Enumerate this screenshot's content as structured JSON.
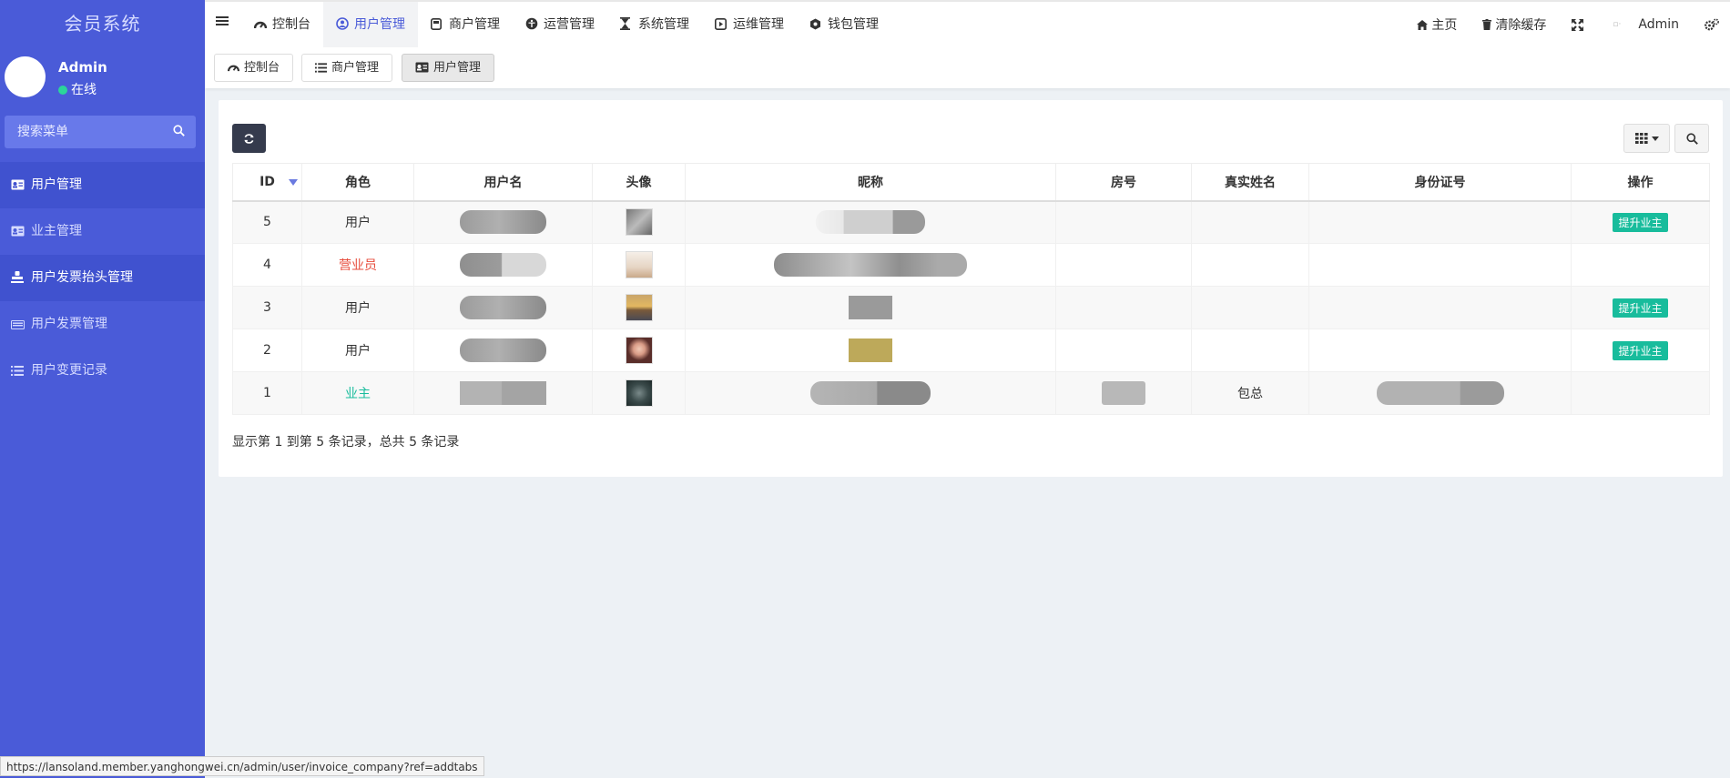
{
  "sidebar": {
    "brand": "会员系统",
    "user_name": "Admin",
    "user_status": "在线",
    "search_placeholder": "搜索菜单",
    "items": [
      {
        "label": "用户管理",
        "icon": "id-card-icon"
      },
      {
        "label": "业主管理",
        "icon": "id-card-icon"
      },
      {
        "label": "用户发票抬头管理",
        "icon": "stamp-icon"
      },
      {
        "label": "用户发票管理",
        "icon": "keyboard-icon"
      },
      {
        "label": "用户变更记录",
        "icon": "list-icon"
      }
    ]
  },
  "topnav": {
    "tabs": [
      {
        "label": "控制台",
        "icon": "dashboard-icon"
      },
      {
        "label": "用户管理",
        "icon": "user-circle-icon"
      },
      {
        "label": "商户管理",
        "icon": "store-icon"
      },
      {
        "label": "运营管理",
        "icon": "universal-access-icon"
      },
      {
        "label": "系统管理",
        "icon": "hourglass-icon"
      },
      {
        "label": "运维管理",
        "icon": "play-square-icon"
      },
      {
        "label": "钱包管理",
        "icon": "wallet-icon"
      }
    ],
    "home": "主页",
    "clear_cache": "清除缓存",
    "admin": "Admin"
  },
  "tabbar": {
    "tabs": [
      {
        "label": "控制台",
        "icon": "dashboard-icon"
      },
      {
        "label": "商户管理",
        "icon": "list-icon"
      },
      {
        "label": "用户管理",
        "icon": "id-card-icon"
      }
    ]
  },
  "table": {
    "headers": [
      "ID",
      "角色",
      "用户名",
      "头像",
      "昵称",
      "房号",
      "真实姓名",
      "身份证号",
      "操作"
    ],
    "rows": [
      {
        "id": "5",
        "role": "用户",
        "real_name": "",
        "action": "提升业主"
      },
      {
        "id": "4",
        "role": "营业员",
        "real_name": "",
        "action": ""
      },
      {
        "id": "3",
        "role": "用户",
        "real_name": "",
        "action": "提升业主"
      },
      {
        "id": "2",
        "role": "用户",
        "real_name": "",
        "action": "提升业主"
      },
      {
        "id": "1",
        "role": "业主",
        "real_name": "包总",
        "action": ""
      }
    ],
    "footer": "显示第 1 到第 5 条记录，总共 5 条记录"
  },
  "statusbar": "https://lansoland.member.yanghongwei.cn/admin/user/invoice_company?ref=addtabs",
  "colors": {
    "sidebar": "#4a5bd8",
    "accent": "#4a5bd8",
    "success": "#18bc9c",
    "danger": "#e74c3c"
  }
}
